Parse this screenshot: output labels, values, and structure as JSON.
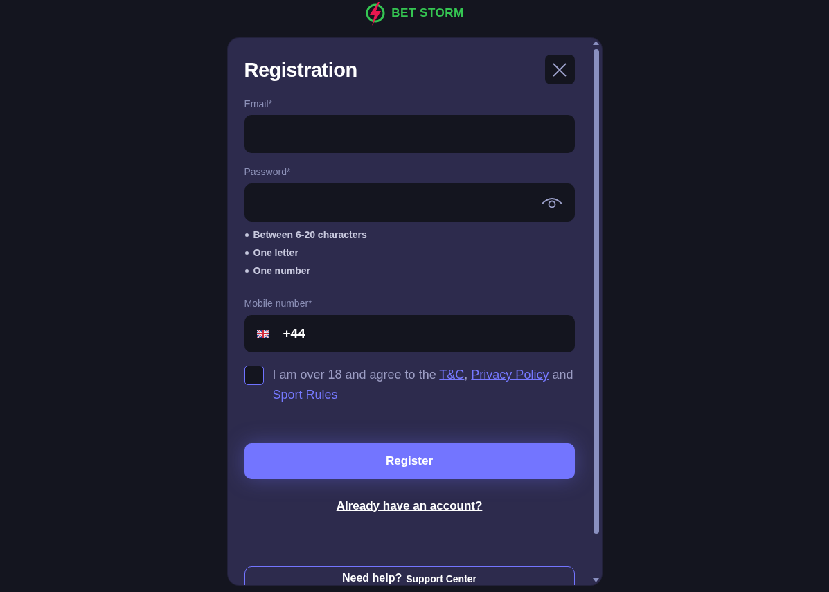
{
  "logo": {
    "text": "BET STORM"
  },
  "modal": {
    "title": "Registration"
  },
  "fields": [
    {
      "kind": "email",
      "label": "Email*"
    },
    {
      "kind": "password",
      "label": "Password*",
      "hints": [
        "Between 6-20 characters",
        "One letter",
        "One number"
      ]
    },
    {
      "kind": "phone",
      "label": "Mobile number*",
      "dial_code": "+44"
    }
  ],
  "agreement": {
    "checked": false,
    "parts": [
      {
        "kind": "text",
        "text": "I am over 18 and agree to the "
      },
      {
        "kind": "link",
        "text": "T&C"
      },
      {
        "kind": "text",
        "text": ", "
      },
      {
        "kind": "link",
        "text": "Privacy Policy"
      },
      {
        "kind": "text",
        "text": " and "
      },
      {
        "kind": "link",
        "text": "Sport Rules"
      }
    ]
  },
  "register_button": {
    "label": "Register"
  },
  "login_link": {
    "label": "Already have an account?"
  },
  "help": {
    "title": "Need help?",
    "link": "Support Center"
  }
}
